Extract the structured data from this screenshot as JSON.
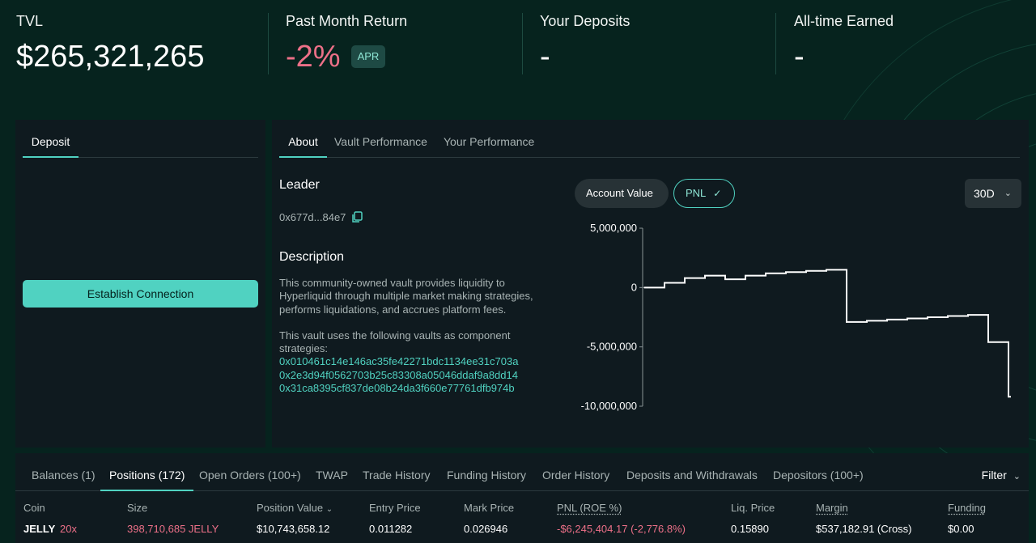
{
  "stats": {
    "tvl": {
      "label": "TVL",
      "value": "$265,321,265"
    },
    "return": {
      "label": "Past Month Return",
      "value": "-2%",
      "badge": "APR"
    },
    "deposits": {
      "label": "Your Deposits",
      "value": "-"
    },
    "earned": {
      "label": "All-time Earned",
      "value": "-"
    }
  },
  "deposit_panel": {
    "tab": "Deposit",
    "button": "Establish Connection"
  },
  "about_panel": {
    "tabs": [
      "About",
      "Vault Performance",
      "Your Performance"
    ],
    "leader_title": "Leader",
    "leader_address": "0x677d...84e7",
    "description_title": "Description",
    "description": "This community-owned vault provides liquidity to Hyperliquid through multiple market making strategies, performs liquidations, and accrues platform fees.",
    "vaults_intro": "This vault uses the following vaults as component strategies:",
    "vaults": [
      "0x010461c14e146ac35fe42271bdc1134ee31c703a",
      "0x2e3d94f0562703b25c83308a05046ddaf9a8dd14",
      "0x31ca8395cf837de08b24da3f660e77761dfb974b"
    ],
    "chart_toggle": {
      "account_value": "Account Value",
      "pnl": "PNL"
    },
    "range": "30D"
  },
  "chart_data": {
    "type": "line",
    "series": [
      {
        "values": [
          0,
          400000,
          800000,
          1000000,
          700000,
          1000000,
          1200000,
          1300000,
          1400000,
          1500000,
          -2900000,
          -2800000,
          -2700000,
          -2600000,
          -2500000,
          -2400000,
          -2300000,
          -4600000,
          -9200000
        ]
      }
    ],
    "yticks": [
      "5,000,000",
      "0",
      "-5,000,000",
      "-10,000,000"
    ],
    "ylim": [
      -10000000,
      5000000
    ],
    "grid": false
  },
  "bottom": {
    "tabs": [
      "Balances (1)",
      "Positions (172)",
      "Open Orders (100+)",
      "TWAP",
      "Trade History",
      "Funding History",
      "Order History",
      "Deposits and Withdrawals",
      "Depositors (100+)"
    ],
    "filter": "Filter",
    "columns": [
      "Coin",
      "Size",
      "Position Value",
      "Entry Price",
      "Mark Price",
      "PNL (ROE %)",
      "Liq. Price",
      "Margin",
      "Funding"
    ],
    "row": {
      "coin": "JELLY",
      "leverage": "20x",
      "size": "398,710,685 JELLY",
      "position_value": "$10,743,658.12",
      "entry_price": "0.011282",
      "mark_price": "0.026946",
      "pnl": "-$6,245,404.17 (-2,776.8%)",
      "liq_price": "0.15890",
      "margin": "$537,182.91 (Cross)",
      "funding": "$0.00"
    }
  }
}
